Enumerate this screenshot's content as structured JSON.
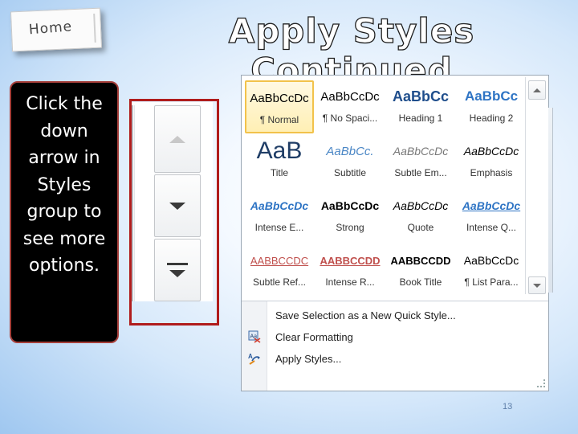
{
  "home_tab": {
    "label": "Home"
  },
  "title": "Apply Styles Continued",
  "callout": {
    "text": "Click the down arrow in Styles group to see more options."
  },
  "gallery": {
    "styles": [
      {
        "sample": "AaBbCcDc",
        "name": "¶ Normal",
        "selected": true
      },
      {
        "sample": "AaBbCcDc",
        "name": "¶ No Spaci..."
      },
      {
        "sample": "AaBbCc",
        "name": "Heading 1"
      },
      {
        "sample": "AaBbCc",
        "name": "Heading 2"
      },
      {
        "sample": "AaB",
        "name": "Title"
      },
      {
        "sample": "AaBbCc.",
        "name": "Subtitle"
      },
      {
        "sample": "AaBbCcDc",
        "name": "Subtle Em..."
      },
      {
        "sample": "AaBbCcDc",
        "name": "Emphasis"
      },
      {
        "sample": "AaBbCcDc",
        "name": "Intense E..."
      },
      {
        "sample": "AaBbCcDc",
        "name": "Strong"
      },
      {
        "sample": "AaBbCcDc",
        "name": "Quote"
      },
      {
        "sample": "AaBbCcDc",
        "name": "Intense Q..."
      },
      {
        "sample": "AABBCCDC",
        "name": "Subtle Ref..."
      },
      {
        "sample": "AABBCCDD",
        "name": "Intense R..."
      },
      {
        "sample": "AABBCCDD",
        "name": "Book Title"
      },
      {
        "sample": "AaBbCcDc",
        "name": "¶ List Para..."
      }
    ],
    "menu": [
      {
        "label": "Save Selection as a New Quick Style...",
        "icon": "none"
      },
      {
        "label": "Clear Formatting",
        "icon": "clear-formatting-icon"
      },
      {
        "label": "Apply Styles...",
        "icon": "apply-styles-icon"
      }
    ]
  },
  "page_number": "13",
  "colors": {
    "callout_border": "#a63f3a",
    "highlight_box": "#b01c1c",
    "selected_style": "#f2c24b",
    "heading_blue": "#1f5fa6"
  }
}
